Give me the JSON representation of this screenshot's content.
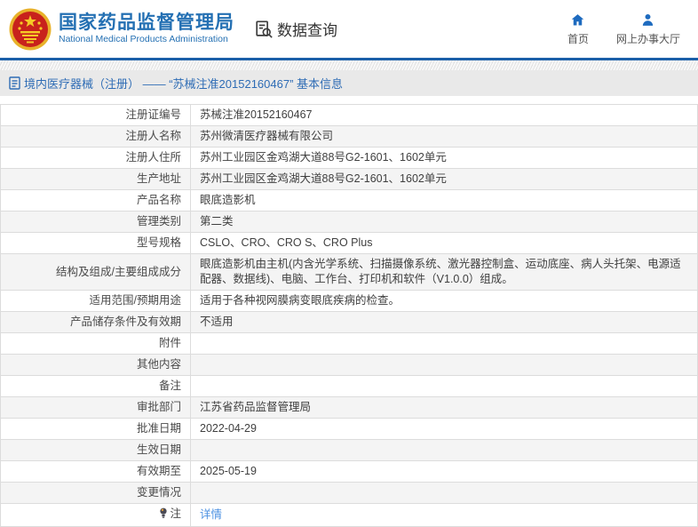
{
  "header": {
    "org_name_zh": "国家药品监督管理局",
    "org_name_en": "National Medical Products Administration",
    "query_label": "数据查询",
    "nav": [
      {
        "label": "首页",
        "icon": "home-icon"
      },
      {
        "label": "网上办事大厅",
        "icon": "person-icon"
      }
    ]
  },
  "breadcrumb": {
    "title": "境内医疗器械（注册） —— “苏械注准20152160467” 基本信息"
  },
  "detail_table": {
    "rows": [
      {
        "label": "注册证编号",
        "value": "苏械注准20152160467"
      },
      {
        "label": "注册人名称",
        "value": "苏州微清医疗器械有限公司"
      },
      {
        "label": "注册人住所",
        "value": "苏州工业园区金鸡湖大道88号G2-1601、1602单元"
      },
      {
        "label": "生产地址",
        "value": "苏州工业园区金鸡湖大道88号G2-1601、1602单元"
      },
      {
        "label": "产品名称",
        "value": "眼底造影机"
      },
      {
        "label": "管理类别",
        "value": "第二类"
      },
      {
        "label": "型号规格",
        "value": "CSLO、CRO、CRO S、CRO Plus"
      },
      {
        "label": "结构及组成/主要组成成分",
        "value": "眼底造影机由主机(内含光学系统、扫描摄像系统、激光器控制盒、运动底座、病人头托架、电源适配器、数据线)、电脑、工作台、打印机和软件（V1.0.0）组成。"
      },
      {
        "label": "适用范围/预期用途",
        "value": "适用于各种视网膜病变眼底疾病的检查。"
      },
      {
        "label": "产品储存条件及有效期",
        "value": "不适用"
      },
      {
        "label": "附件",
        "value": ""
      },
      {
        "label": "其他内容",
        "value": ""
      },
      {
        "label": "备注",
        "value": ""
      },
      {
        "label": "审批部门",
        "value": "江苏省药品监督管理局"
      },
      {
        "label": "批准日期",
        "value": "2022-04-29"
      },
      {
        "label": "生效日期",
        "value": ""
      },
      {
        "label": "有效期至",
        "value": "2025-05-19"
      },
      {
        "label": "变更情况",
        "value": ""
      },
      {
        "label": "注",
        "icon": "bulb-icon",
        "value": "详情",
        "link": true
      }
    ]
  },
  "colors": {
    "brand_blue": "#2470b3",
    "title_blue": "#2e6cb5",
    "link_blue": "#4a90e2",
    "divider_blue": "#1b5fa8",
    "breadcrumb_bg": "#e9e9e9",
    "row_alt_gray": "#f4f4f4",
    "table_border": "#dcdcdc"
  }
}
